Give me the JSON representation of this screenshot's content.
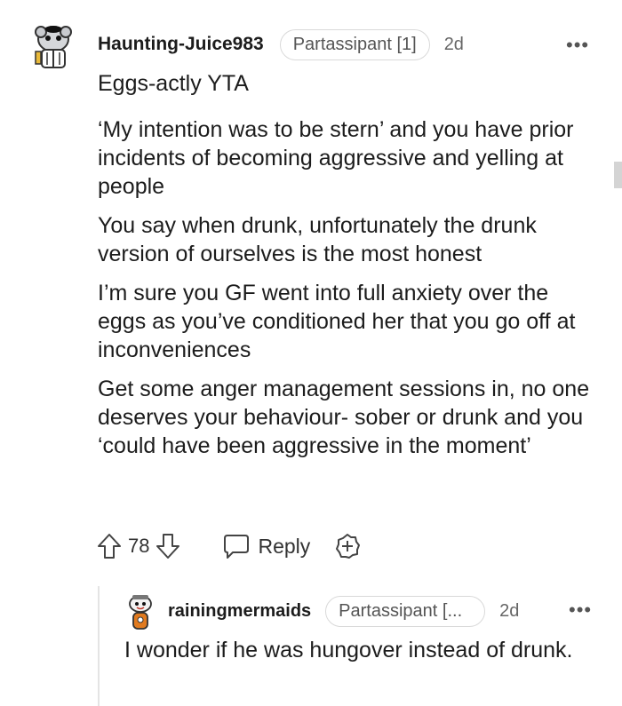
{
  "comment": {
    "username": "Haunting-Juice983",
    "flair": "Partassipant [1]",
    "time": "2d",
    "more_label": "•••",
    "paragraphs": [
      "Eggs-actly YTA",
      "‘My intention was to be stern’ and you have prior incidents of becoming aggressive and yelling at people",
      "You say when drunk, unfortunately the drunk version of ourselves is the most honest",
      "I’m sure you GF went into full anxiety over the eggs as you’ve conditioned her that you go off at inconveniences",
      "Get some anger management sessions in, no one deserves your behaviour- sober or drunk and you ‘could have been aggressive in the moment’"
    ],
    "vote_count": "78",
    "reply_label": "Reply"
  },
  "reply": {
    "username": "rainingmermaids",
    "flair": "Partassipant [...",
    "time": "2d",
    "more_label": "•••",
    "text": "I wonder if he was hungover instead of drunk."
  },
  "icons": {
    "upvote": "upvote-arrow-icon",
    "downvote": "downvote-arrow-icon",
    "reply": "speech-bubble-icon",
    "award": "award-plus-icon"
  }
}
